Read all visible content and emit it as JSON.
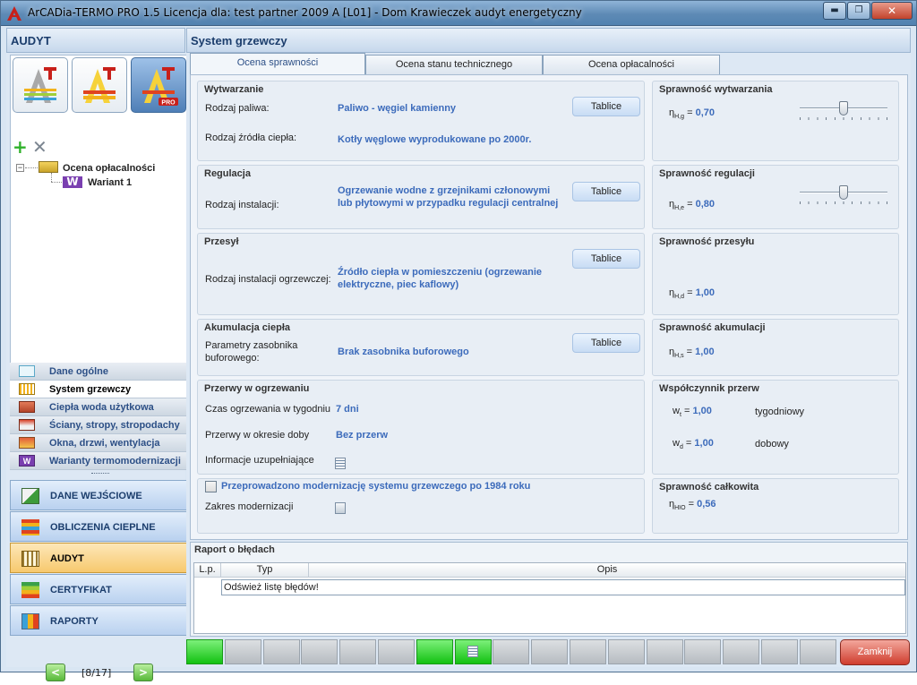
{
  "window": {
    "title": "ArCADia-TERMO PRO 1.5 Licencja dla: test partner 2009 A [L01] - Dom Krawieczek audyt energetyczny",
    "min_label": "▬",
    "max_label": "❐",
    "close_label": "✕"
  },
  "left": {
    "header": "AUDYT",
    "tree": {
      "root": "Ocena opłacalności",
      "child": "Wariant 1",
      "expander": "−"
    },
    "nav": [
      {
        "label": "Dane ogólne",
        "icon": "document-icon"
      },
      {
        "label": "System grzewczy",
        "icon": "radiator-icon"
      },
      {
        "label": "Ciepła woda użytkowa",
        "icon": "faucet-icon"
      },
      {
        "label": "Ściany, stropy, stropodachy",
        "icon": "house-icon"
      },
      {
        "label": "Okna, drzwi, wentylacja",
        "icon": "window-icon"
      },
      {
        "label": "Warianty termomodernizacji",
        "icon": "variant-icon"
      }
    ],
    "modules": [
      {
        "label": "DANE WEJŚCIOWE"
      },
      {
        "label": "OBLICZENIA CIEPLNE"
      },
      {
        "label": "AUDYT"
      },
      {
        "label": "CERTYFIKAT"
      },
      {
        "label": "RAPORTY"
      }
    ],
    "pager": {
      "text": "[8/17]",
      "prev": "<",
      "next": ">"
    }
  },
  "main": {
    "header": "System grzewczy",
    "tabs": [
      "Ocena sprawności",
      "Ocena stanu technicznego",
      "Ocena opłacalności"
    ],
    "wytwarzanie": {
      "title": "Wytwarzanie",
      "fuel_label": "Rodzaj paliwa:",
      "fuel_value": "Paliwo - węgiel kamienny",
      "source_label": "Rodzaj źródła ciepła:",
      "source_value": "Kotły węglowe wyprodukowane po 2000r.",
      "button": "Tablice"
    },
    "regulacja": {
      "title": "Regulacja",
      "label": "Rodzaj instalacji:",
      "value": "Ogrzewanie wodne z grzejnikami członowymi lub płytowymi w przypadku regulacji centralnej",
      "button": "Tablice"
    },
    "przesyl": {
      "title": "Przesył",
      "label": "Rodzaj instalacji ogrzewczej:",
      "value": "Źródło ciepła w pomieszczeniu (ogrzewanie elektryczne, piec kaflowy)",
      "button": "Tablice"
    },
    "akumulacja": {
      "title": "Akumulacja ciepła",
      "label": "Parametry zasobnika buforowego:",
      "value": "Brak zasobnika buforowego",
      "button": "Tablice"
    },
    "przerwy": {
      "title": "Przerwy w ogrzewaniu",
      "time_label": "Czas ogrzewania w tygodniu",
      "time_value": "7 dni",
      "break_label": "Przerwy w okresie doby",
      "break_value": "Bez przerw",
      "info_label": "Informacje uzupełniające"
    },
    "modernizacja": {
      "checkbox_label": "Przeprowadzono modernizację systemu grzewczego po 1984 roku",
      "checked": false,
      "scope_label": "Zakres modernizacji"
    },
    "spr_wytwarzania": {
      "title": "Sprawność wytwarzania",
      "symbol": "η",
      "sub": "H,g",
      "value": "0,70",
      "slider_fraction": 0.5
    },
    "spr_regulacji": {
      "title": "Sprawność regulacji",
      "symbol": "η",
      "sub": "H,e",
      "value": "0,80",
      "slider_fraction": 0.5
    },
    "spr_przesylu": {
      "title": "Sprawność przesyłu",
      "symbol": "η",
      "sub": "H,d",
      "value": "1,00"
    },
    "spr_akumulacji": {
      "title": "Sprawność akumulacji",
      "symbol": "η",
      "sub": "H,s",
      "value": "1,00"
    },
    "przerw": {
      "title": "Współczynnik przerw",
      "wt_symbol": "w",
      "wt_sub": "t",
      "wt_value": "1,00",
      "wt_label": "tygodniowy",
      "wd_symbol": "w",
      "wd_sub": "d",
      "wd_value": "1,00",
      "wd_label": "dobowy"
    },
    "spr_calkowita": {
      "title": "Sprawność całkowita",
      "symbol": "η",
      "sub": "HIO",
      "value": "0,56"
    }
  },
  "errors": {
    "title": "Raport o błędach",
    "columns": [
      "L.p.",
      "Typ",
      "Opis"
    ],
    "row": "Odśwież listę błędów!"
  },
  "statusbar": {
    "segments": [
      true,
      false,
      false,
      false,
      false,
      false,
      true,
      false,
      false,
      false,
      false,
      false,
      false,
      false,
      false,
      false,
      false
    ],
    "doc_icon": "document-icon"
  },
  "close_button": "Zamknij",
  "colors": {
    "accent": "#3c6bbb",
    "header_text": "#1b3d6c",
    "active_module": "#f7c96e",
    "close_red": "#cf3d2e",
    "status_green": "#13c112"
  }
}
